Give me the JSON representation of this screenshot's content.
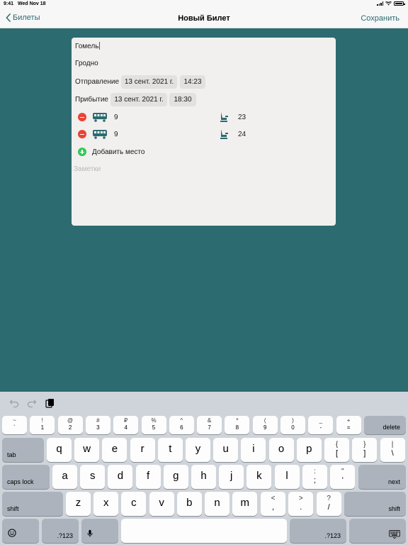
{
  "status_bar": {
    "time": "9:41",
    "date": "Wed Nov 18"
  },
  "nav": {
    "back_label": "Билеты",
    "title": "Новый Билет",
    "save_label": "Сохранить"
  },
  "form": {
    "from_city": "Гомель",
    "to_city": "Гродно",
    "departure": {
      "label": "Отправление",
      "date": "13 сент. 2021 г.",
      "time": "14:23"
    },
    "arrival": {
      "label": "Прибытие",
      "date": "13 сент. 2021 г.",
      "time": "18:30"
    },
    "seats": [
      {
        "wagon": "9",
        "seat": "23"
      },
      {
        "wagon": "9",
        "seat": "24"
      }
    ],
    "add_seat_label": "Добавить место",
    "notes_placeholder": "Заметки"
  },
  "keyboard": {
    "number_row": [
      {
        "sym": "~",
        "main": "`"
      },
      {
        "sym": "!",
        "main": "1"
      },
      {
        "sym": "@",
        "main": "2"
      },
      {
        "sym": "#",
        "main": "3"
      },
      {
        "sym": "₽",
        "main": "4"
      },
      {
        "sym": "%",
        "main": "5"
      },
      {
        "sym": "^",
        "main": "6"
      },
      {
        "sym": "&",
        "main": "7"
      },
      {
        "sym": "*",
        "main": "8"
      },
      {
        "sym": "(",
        "main": "9"
      },
      {
        "sym": ")",
        "main": "0"
      },
      {
        "sym": "_",
        "main": "-"
      },
      {
        "sym": "+",
        "main": "="
      }
    ],
    "delete_label": "delete",
    "tab_label": "tab",
    "row_q": [
      "q",
      "w",
      "e",
      "r",
      "t",
      "y",
      "u",
      "i",
      "o",
      "p"
    ],
    "row_q_dual": [
      {
        "top": "{",
        "bot": "["
      },
      {
        "top": "}",
        "bot": "]"
      },
      {
        "top": "|",
        "bot": "\\"
      }
    ],
    "caps_label": "caps lock",
    "row_a": [
      "a",
      "s",
      "d",
      "f",
      "g",
      "h",
      "j",
      "k",
      "l"
    ],
    "row_a_dual": [
      {
        "top": ":",
        "bot": ";"
      },
      {
        "top": "\"",
        "bot": "'"
      }
    ],
    "next_label": "next",
    "shift_label": "shift",
    "row_z": [
      "z",
      "x",
      "c",
      "v",
      "b",
      "n",
      "m"
    ],
    "row_z_dual": [
      {
        "top": "<",
        "bot": ","
      },
      {
        "top": ">",
        "bot": "."
      },
      {
        "top": "?",
        "bot": "/"
      }
    ],
    "numbers_label": ".?123"
  }
}
